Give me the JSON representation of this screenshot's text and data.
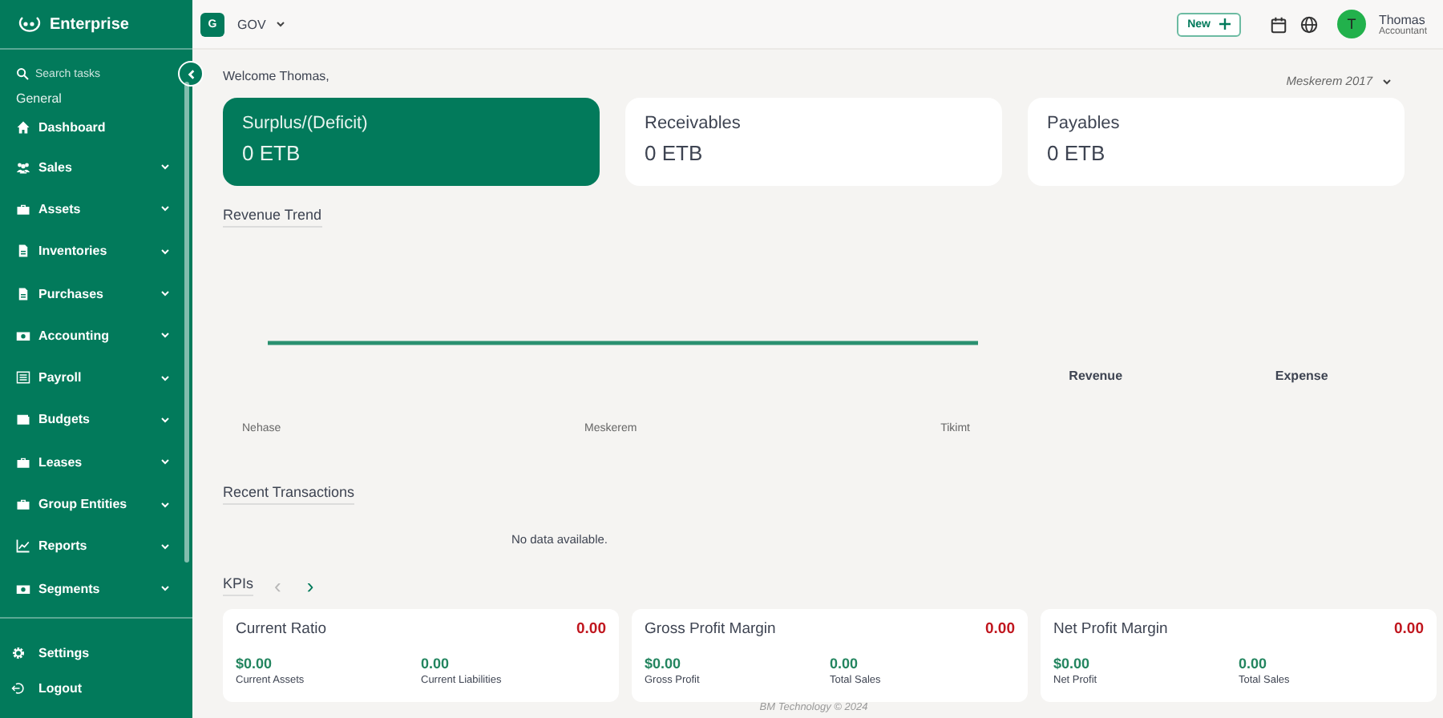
{
  "brand": {
    "name": "Enterprise"
  },
  "sidebar": {
    "search": {
      "placeholder": "Search tasks"
    },
    "section": "General",
    "items": [
      {
        "label": "Dashboard",
        "kind": "link"
      },
      {
        "label": "Sales",
        "kind": "group",
        "expanded": false
      },
      {
        "label": "Assets",
        "kind": "group",
        "expanded": false
      },
      {
        "label": "Inventories",
        "kind": "group",
        "expanded": false
      },
      {
        "label": "Purchases",
        "kind": "group",
        "expanded": false
      },
      {
        "label": "Accounting",
        "kind": "group",
        "expanded": false
      },
      {
        "label": "Payroll",
        "kind": "group",
        "expanded": false
      },
      {
        "label": "Budgets",
        "kind": "group",
        "expanded": false
      },
      {
        "label": "Leases",
        "kind": "group",
        "expanded": false
      },
      {
        "label": "Group Entities",
        "kind": "group",
        "expanded": false
      },
      {
        "label": "Reports",
        "kind": "group",
        "expanded": false
      },
      {
        "label": "Segments",
        "kind": "group",
        "expanded": false
      }
    ],
    "footer": [
      {
        "label": "Settings"
      },
      {
        "label": "Logout"
      }
    ]
  },
  "topbar": {
    "org_badge": "G",
    "org": "GOV",
    "new_button": "New",
    "user": {
      "initial": "T",
      "name": "Thomas",
      "role": "Accountant"
    }
  },
  "welcome": "Welcome Thomas,",
  "period": "Meskerem 2017",
  "summary": [
    {
      "title": "Surplus/(Deficit)",
      "value": "0 ETB",
      "selected": true
    },
    {
      "title": "Receivables",
      "value": "0 ETB",
      "selected": false
    },
    {
      "title": "Payables",
      "value": "0 ETB",
      "selected": false
    }
  ],
  "revenue_trend": {
    "title": "Revenue Trend",
    "x_labels": [
      "Nehase",
      "Meskerem",
      "Tikimt"
    ],
    "legend": [
      "Revenue",
      "Expense"
    ]
  },
  "recent_transactions": {
    "title": "Recent Transactions",
    "empty": "No data available."
  },
  "kpis": {
    "title": "KPIs",
    "prev": {
      "label": "‹",
      "disabled": true
    },
    "next": {
      "label": "›",
      "disabled": false
    },
    "cards": [
      {
        "title": "Current Ratio",
        "value": "0.00",
        "a_value": "$0.00",
        "a_label": "Current Assets",
        "b_value": "0.00",
        "b_label": "Current Liabilities"
      },
      {
        "title": "Gross Profit Margin",
        "value": "0.00",
        "a_value": "$0.00",
        "a_label": "Gross Profit",
        "b_value": "0.00",
        "b_label": "Total Sales"
      },
      {
        "title": "Net Profit Margin",
        "value": "0.00",
        "a_value": "$0.00",
        "a_label": "Net Profit",
        "b_value": "0.00",
        "b_label": "Total Sales"
      }
    ]
  },
  "footer": "BM Technology © 2024"
}
